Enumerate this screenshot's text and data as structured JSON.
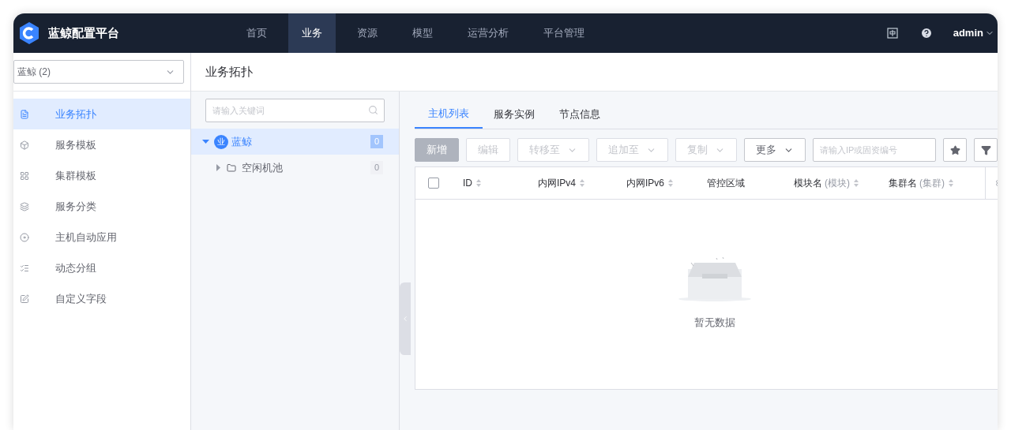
{
  "app": {
    "name": "蓝鲸配置平台"
  },
  "nav": [
    {
      "label": "首页",
      "selected": false
    },
    {
      "label": "业务",
      "selected": true
    },
    {
      "label": "资源",
      "selected": false
    },
    {
      "label": "模型",
      "selected": false
    },
    {
      "label": "运营分析",
      "selected": false
    },
    {
      "label": "平台管理",
      "selected": false
    }
  ],
  "user": {
    "name": "admin"
  },
  "business_select": {
    "value": "蓝鲸 (2)"
  },
  "sidebar": {
    "items": [
      {
        "label": "业务拓扑",
        "selected": true
      },
      {
        "label": "服务模板",
        "selected": false
      },
      {
        "label": "集群模板",
        "selected": false
      },
      {
        "label": "服务分类",
        "selected": false
      },
      {
        "label": "主机自动应用",
        "selected": false
      },
      {
        "label": "动态分组",
        "selected": false
      },
      {
        "label": "自定义字段",
        "selected": false
      }
    ]
  },
  "page_title": "业务拓扑",
  "tree": {
    "search": {
      "placeholder": "请输入关键词"
    },
    "nodes": [
      {
        "badge": "业",
        "label": "蓝鲸",
        "count": "0",
        "selected": true,
        "expanded": true,
        "children": [
          {
            "label": "空闲机池",
            "count": "0",
            "selected": false,
            "expanded": false
          }
        ]
      }
    ]
  },
  "tabs": [
    {
      "label": "主机列表",
      "selected": true
    },
    {
      "label": "服务实例",
      "selected": false
    },
    {
      "label": "节点信息",
      "selected": false
    }
  ],
  "toolbar": {
    "buttons": [
      {
        "label": "新增",
        "kind": "primary",
        "disabled": true,
        "dropdown": false
      },
      {
        "label": "编辑",
        "kind": "default",
        "disabled": true,
        "dropdown": false
      },
      {
        "label": "转移至",
        "kind": "default",
        "disabled": true,
        "dropdown": true
      },
      {
        "label": "追加至",
        "kind": "default",
        "disabled": true,
        "dropdown": true
      },
      {
        "label": "复制",
        "kind": "default",
        "disabled": true,
        "dropdown": true
      },
      {
        "label": "更多",
        "kind": "default",
        "disabled": false,
        "dropdown": true
      }
    ],
    "search": {
      "placeholder": "请输入IP或固资编号"
    }
  },
  "table": {
    "select_all": {
      "checked": false
    },
    "columns": [
      {
        "label": "ID",
        "sortable": true
      },
      {
        "label": "内网IPv4",
        "sortable": true
      },
      {
        "label": "内网IPv6",
        "sortable": true
      },
      {
        "label": "管控区域",
        "sortable": false
      },
      {
        "label": "模块名",
        "sub": "(模块)",
        "sortable": true
      },
      {
        "label": "集群名",
        "sub": "(集群)",
        "sortable": true
      }
    ],
    "empty_text": "暂无数据"
  }
}
